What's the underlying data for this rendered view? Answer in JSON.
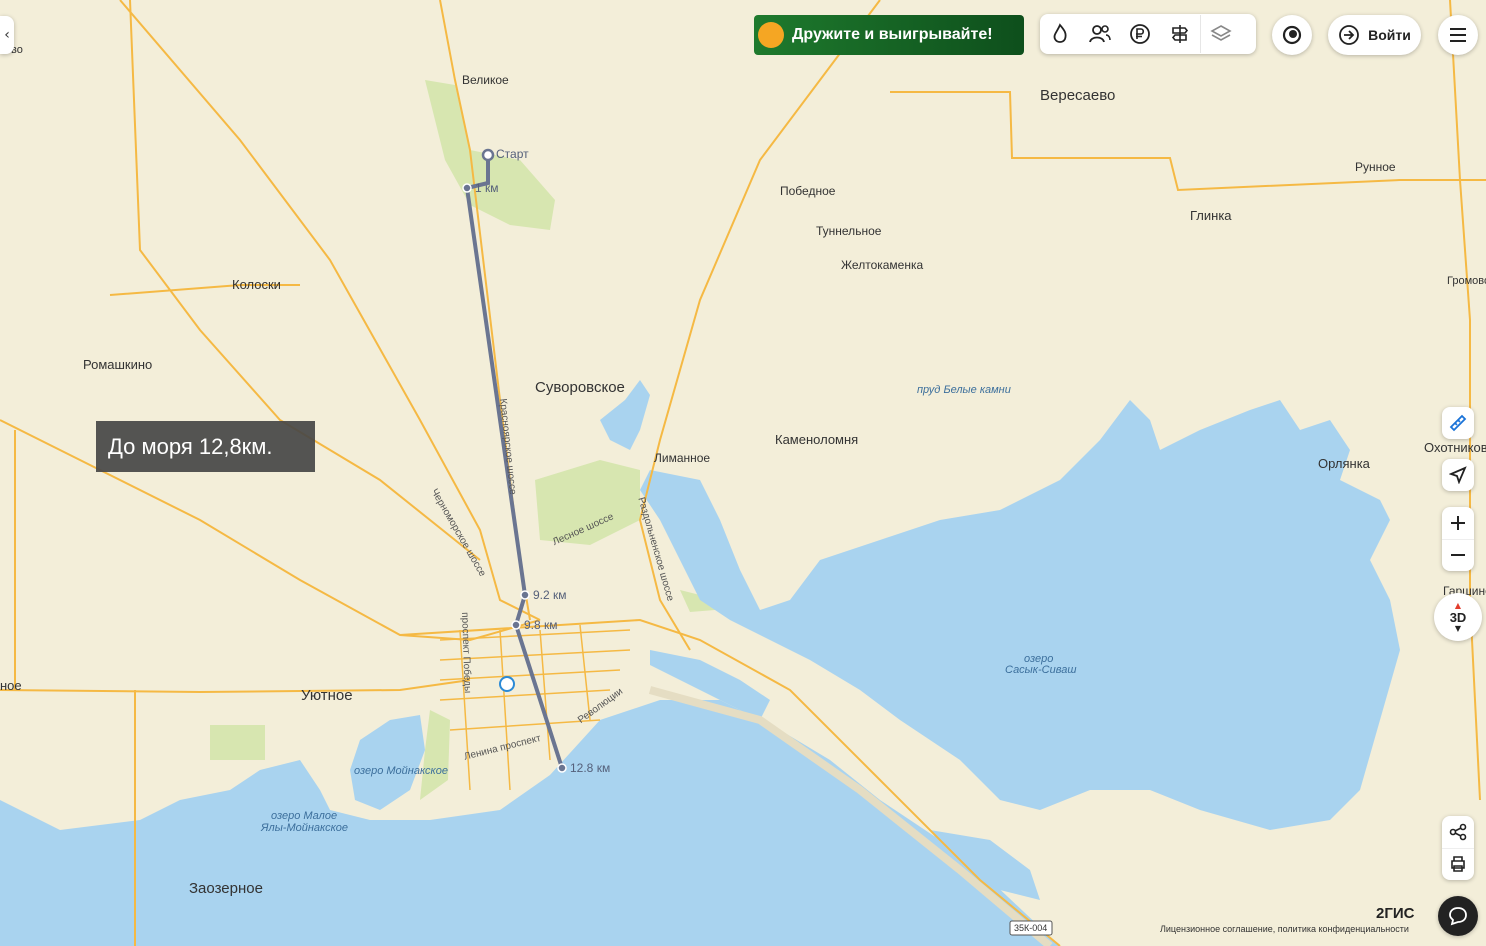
{
  "promo": {
    "text": "Дружите и выигрывайте!"
  },
  "header": {
    "login_label": "Войти"
  },
  "tooltip": {
    "text": "До моря 12,8км."
  },
  "places": {
    "velikoe": "Великое",
    "veresaevo": "Вересаево",
    "runnoe": "Рунное",
    "pobednoe": "Победное",
    "glinka": "Глинка",
    "tunnelnoe": "Туннельное",
    "zheltokamenka": "Желтокаменка",
    "gromovo": "Громово",
    "koloski": "Колоски",
    "romashkino": "Ромашкино",
    "suvorovskoe": "Суворовское",
    "kamenolomnya": "Каменоломня",
    "limannoe": "Лиманное",
    "okhotnikovo": "Охотниково",
    "orlyanka": "Орлянка",
    "garshino": "Гаршино",
    "utnoe": "Уютное",
    "zaozernoe": "Заозерное",
    "left_edge_top": "ково",
    "left_edge_mid": "ное"
  },
  "water": {
    "prud": "пруд Белые камни",
    "sasyk_1": "озеро",
    "sasyk_2": "Сасык-Сиваш",
    "moynakskoe": "озеро Мойнакское",
    "maloe_1": "озеро Малое",
    "maloe_2": "Ялы-Мойнакское"
  },
  "streets": {
    "krasnoyarskoe": "Красноярское шоссе",
    "chernomorskoe": "Черноморское шоссе",
    "lesnoe": "Лесное шоссе",
    "razdolnenskoe": "Раздольненское шоссе",
    "pobedy": "проспект Победы",
    "lenina": "Ленина проспект",
    "revolyutsii": "Революции",
    "road_number": "35К-004"
  },
  "route": {
    "start": "Старт",
    "p1": "1 км",
    "p2": "9.2 км",
    "p3": "9.8 км",
    "p4": "12.8 км"
  },
  "controls": {
    "view_3d": "3D"
  },
  "footer": {
    "logo": "2ГИС",
    "license": "Лицензионное соглашение, политика конфиденциальности"
  },
  "colors": {
    "land": "#f3eed9",
    "water": "#a9d3ef",
    "road": "#f5b944",
    "route": "#6a7591",
    "forest": "#cfe3a4"
  }
}
